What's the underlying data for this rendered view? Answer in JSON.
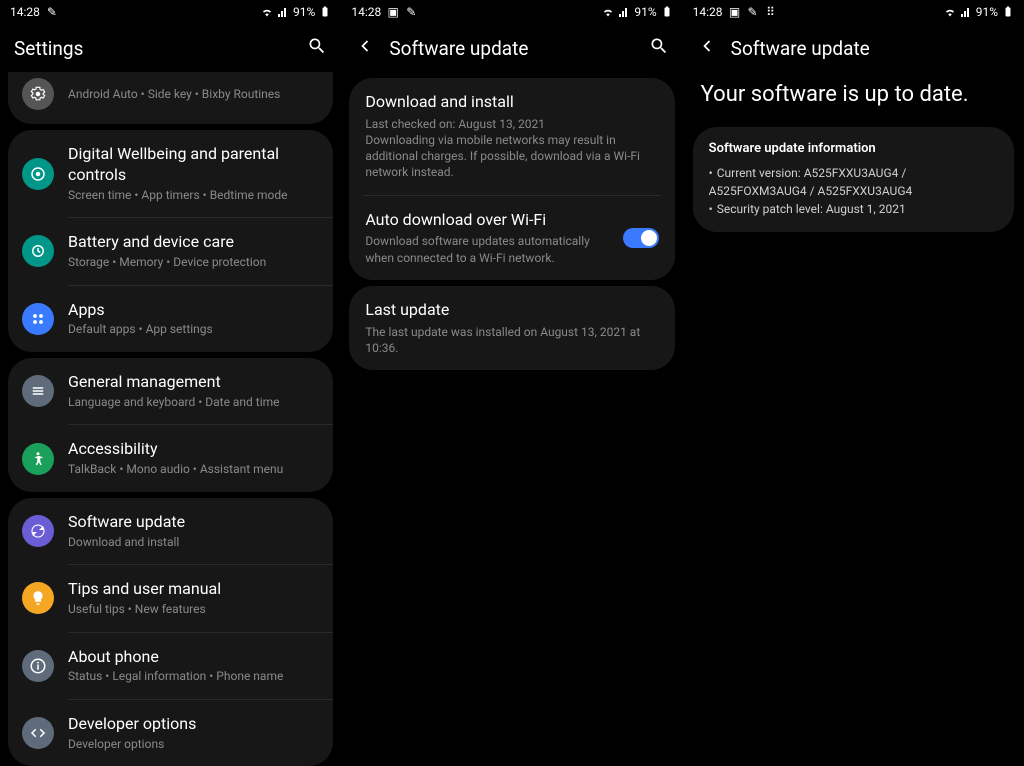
{
  "status": {
    "time": "14:28",
    "battery": "91%"
  },
  "panel1": {
    "title": "Settings",
    "groups": [
      {
        "items": [
          {
            "icon": "advanced",
            "title": "",
            "sub": "Android Auto  •  Side key  •  Bixby Routines"
          }
        ]
      },
      {
        "items": [
          {
            "icon": "wellbeing",
            "title": "Digital Wellbeing and parental controls",
            "sub": "Screen time  •  App timers  •  Bedtime mode"
          },
          {
            "icon": "battery",
            "title": "Battery and device care",
            "sub": "Storage  •  Memory  •  Device protection"
          },
          {
            "icon": "apps",
            "title": "Apps",
            "sub": "Default apps  •  App settings"
          }
        ]
      },
      {
        "items": [
          {
            "icon": "general",
            "title": "General management",
            "sub": "Language and keyboard  •  Date and time"
          },
          {
            "icon": "accessibility",
            "title": "Accessibility",
            "sub": "TalkBack  •  Mono audio  •  Assistant menu"
          }
        ]
      },
      {
        "items": [
          {
            "icon": "update",
            "title": "Software update",
            "sub": "Download and install"
          },
          {
            "icon": "tips",
            "title": "Tips and user manual",
            "sub": "Useful tips  •  New features"
          },
          {
            "icon": "about",
            "title": "About phone",
            "sub": "Status  •  Legal information  •  Phone name"
          },
          {
            "icon": "dev",
            "title": "Developer options",
            "sub": "Developer options"
          }
        ]
      }
    ]
  },
  "panel2": {
    "title": "Software update",
    "group1": {
      "download": {
        "title": "Download and install",
        "sub": "Last checked on: August 13, 2021\nDownloading via mobile networks may result in additional charges. If possible, download via a Wi-Fi network instead."
      },
      "auto": {
        "title": "Auto download over Wi-Fi",
        "sub": "Download software updates automatically when connected to a Wi-Fi network."
      }
    },
    "group2": {
      "last": {
        "title": "Last update",
        "sub": "The last update was installed on August 13, 2021 at 10:36."
      }
    }
  },
  "panel3": {
    "title": "Software update",
    "heading": "Your software is up to date.",
    "info": {
      "heading": "Software update information",
      "lines": [
        "Current version: A525FXXU3AUG4 / A525FOXM3AUG4 / A525FXXU3AUG4",
        "Security patch level: August 1, 2021"
      ]
    }
  }
}
